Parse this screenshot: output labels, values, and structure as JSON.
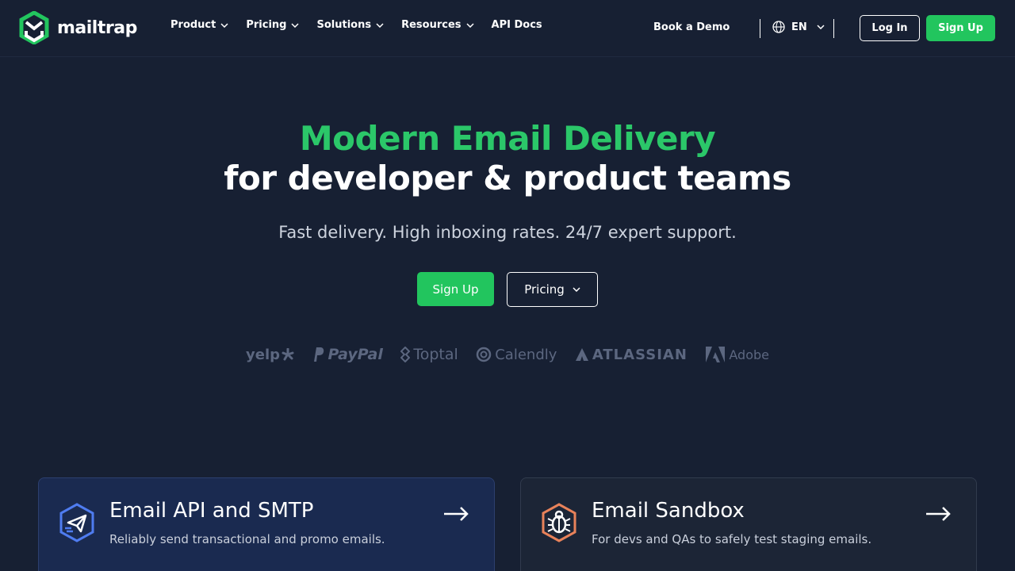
{
  "header": {
    "logo_text": "mailtrap",
    "nav": [
      {
        "label": "Product",
        "dropdown": true
      },
      {
        "label": "Pricing",
        "dropdown": true
      },
      {
        "label": "Solutions",
        "dropdown": true
      },
      {
        "label": "Resources",
        "dropdown": true
      },
      {
        "label": "API Docs",
        "dropdown": false
      }
    ],
    "book_demo": "Book a Demo",
    "language": "EN",
    "login": "Log In",
    "signup": "Sign Up"
  },
  "hero": {
    "title_line1": "Modern Email Delivery",
    "title_line2": "for developer & product teams",
    "subtitle": "Fast delivery. High inboxing rates. 24/7 expert support.",
    "signup": "Sign Up",
    "pricing": "Pricing"
  },
  "logos": [
    "yelp",
    "PayPal",
    "Toptal",
    "Calendly",
    "ATLASSIAN",
    "Adobe"
  ],
  "cards": [
    {
      "title": "Email API and SMTP",
      "description": "Reliably send transactional and promo emails.",
      "icon": "send-icon"
    },
    {
      "title": "Email Sandbox",
      "description": "For devs and QAs to safely test staging emails.",
      "icon": "bug-icon"
    }
  ],
  "colors": {
    "background": "#172033",
    "accent_green": "#22c55e",
    "title_green": "#2bc769",
    "api_blue": "#4f7cf0",
    "sandbox_orange": "#e8825a"
  }
}
